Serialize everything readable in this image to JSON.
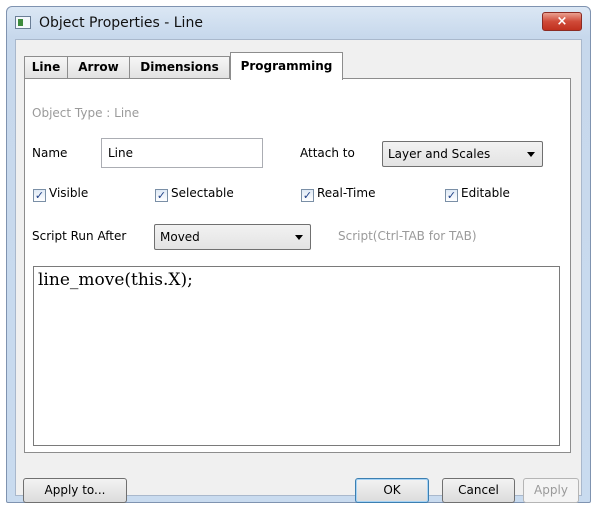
{
  "window": {
    "title": "Object Properties - Line",
    "close_label": "×"
  },
  "tabs": [
    {
      "label": "Line",
      "active": false
    },
    {
      "label": "Arrow",
      "active": false
    },
    {
      "label": "Dimensions",
      "active": false
    },
    {
      "label": "Programming",
      "active": true
    }
  ],
  "programming": {
    "object_type": "Object Type : Line",
    "name_label": "Name",
    "name_value": "Line",
    "attach_label": "Attach to",
    "attach_value": "Layer and Scales",
    "checkboxes": [
      {
        "label": "Visible",
        "checked": true
      },
      {
        "label": "Selectable",
        "checked": true
      },
      {
        "label": "Real-Time",
        "checked": true
      },
      {
        "label": "Editable",
        "checked": true
      }
    ],
    "script_run_after_label": "Script Run After",
    "script_run_after_value": "Moved",
    "script_hint": "Script(Ctrl-TAB for TAB)",
    "script_text": "line_move(this.X);"
  },
  "buttons": {
    "apply_to": "Apply to...",
    "ok": "OK",
    "cancel": "Cancel",
    "apply": "Apply"
  }
}
